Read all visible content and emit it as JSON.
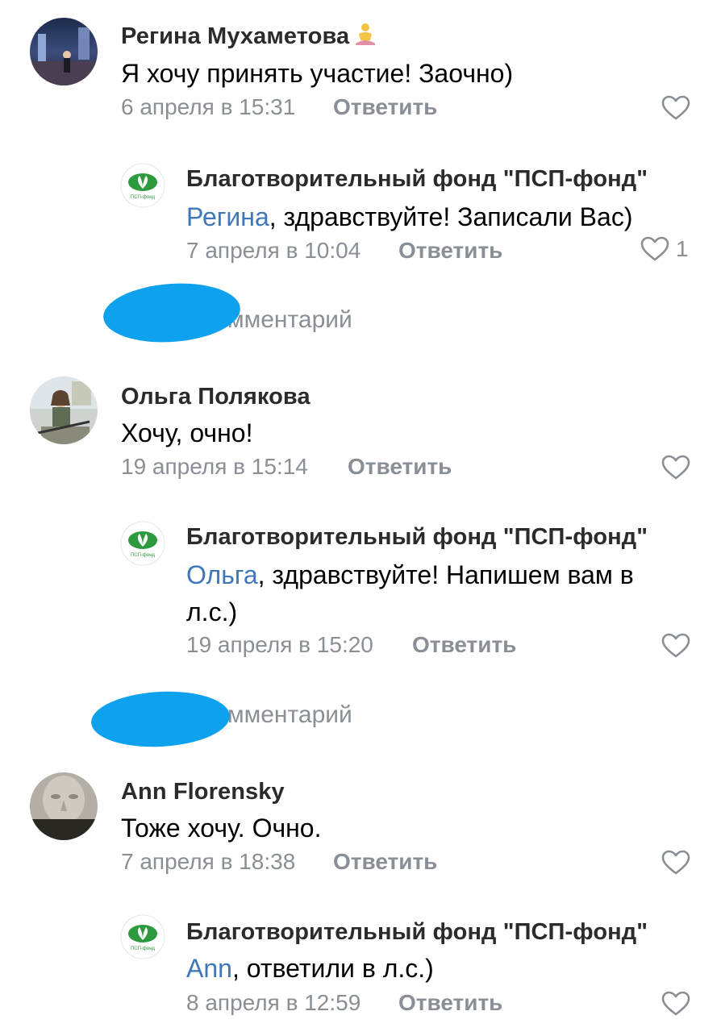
{
  "comments": [
    {
      "author": "Регина Мухаметова",
      "author_emoji": "lotus-position-emoji",
      "text": "Я хочу принять участие! Заочно)",
      "date": "6 апреля в 15:31",
      "reply_label": "Ответить",
      "reply": {
        "author": "Благотворительный фонд \"ПСП-фонд\"",
        "mention": "Регина",
        "text": ", здравствуйте! Записали Вас)",
        "date": "7 апреля в 10:04",
        "reply_label": "Ответить",
        "likes": "1"
      }
    },
    {
      "author": "Ольга Полякова",
      "text": "Хочу, очно!",
      "date": "19 апреля в 15:14",
      "reply_label": "Ответить",
      "reply": {
        "author": "Благотворительный фонд \"ПСП-фонд\"",
        "mention": "Ольга",
        "text": ", здравствуйте! Напишем вам в",
        "text_line2": "л.с.)",
        "date": "19 апреля в 15:20",
        "reply_label": "Ответить"
      }
    },
    {
      "author": "Ann Florensky",
      "text": "Тоже хочу. Очно.",
      "date": "7 апреля в 18:38",
      "reply_label": "Ответить",
      "reply": {
        "author": "Благотворительный фонд \"ПСП-фонд\"",
        "mention": "Ann",
        "text": ", ответили в л.с.)",
        "date": "8 апреля в 12:59",
        "reply_label": "Ответить"
      }
    }
  ],
  "more_comments_label": "мментарий",
  "fund_logo_text": "ПСП-фонд",
  "colors": {
    "mention": "#3f77b9",
    "meta": "#8a8f96",
    "redaction": "#0ea1ee",
    "logo_green": "#2e9a3e"
  }
}
